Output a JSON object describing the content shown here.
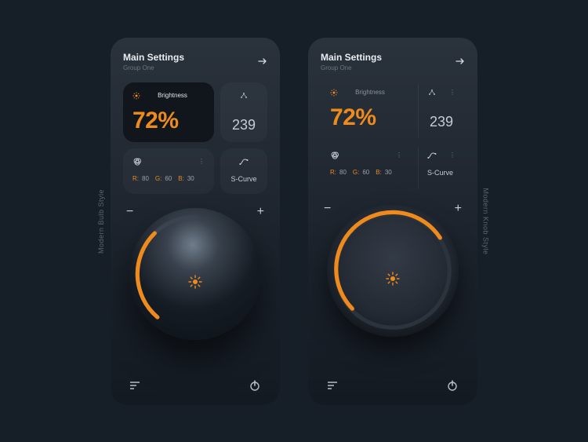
{
  "labels": {
    "left_style": "Modern Bulb Style",
    "right_style": "Modern Knob Style"
  },
  "colors": {
    "accent": "#ef8a1d",
    "bg": "#161e28"
  },
  "screens": [
    {
      "header": {
        "title": "Main Settings",
        "subtitle": "Group One"
      },
      "brightness": {
        "label": "Brightness",
        "value_display": "72%",
        "value": 72
      },
      "secondary": {
        "value_display": "239"
      },
      "rgb": {
        "r_label": "R:",
        "r": "80",
        "g_label": "G:",
        "g": "60",
        "b_label": "B:",
        "b": "30"
      },
      "curve": {
        "value": "S-Curve"
      },
      "knob": {
        "minus": "−",
        "plus": "+"
      },
      "style": "bulb"
    },
    {
      "header": {
        "title": "Main Settings",
        "subtitle": "Group One"
      },
      "brightness": {
        "label": "Brightness",
        "value_display": "72%",
        "value": 72
      },
      "secondary": {
        "value_display": "239"
      },
      "rgb": {
        "r_label": "R:",
        "r": "80",
        "g_label": "G:",
        "g": "60",
        "b_label": "B:",
        "b": "30"
      },
      "curve": {
        "value": "S-Curve"
      },
      "knob": {
        "minus": "−",
        "plus": "+"
      },
      "style": "flat"
    }
  ]
}
